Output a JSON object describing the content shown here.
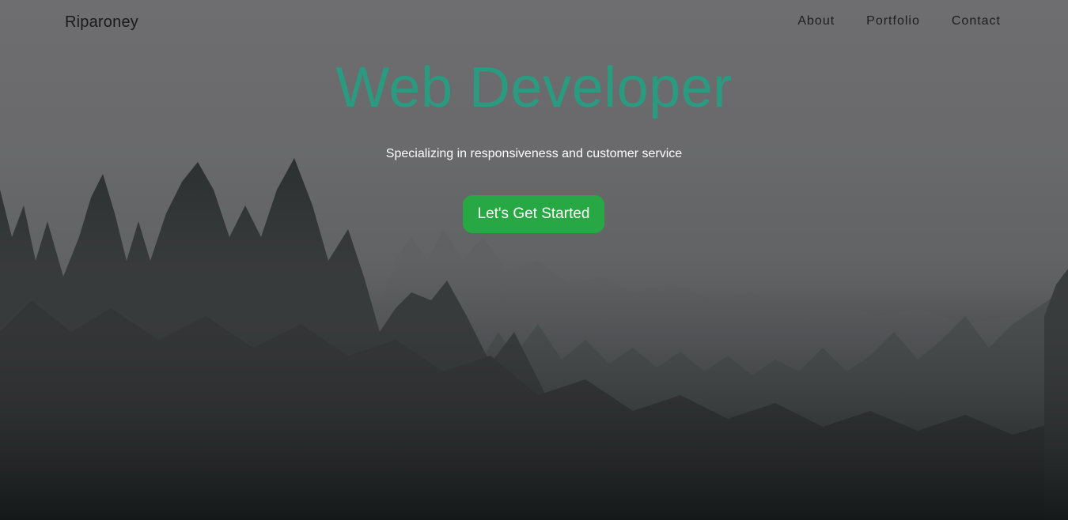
{
  "brand": {
    "name": "Riparoney"
  },
  "nav": {
    "items": [
      {
        "label": "About"
      },
      {
        "label": "Portfolio"
      },
      {
        "label": "Contact"
      }
    ]
  },
  "hero": {
    "title": "Web Developer",
    "subtitle": "Specializing in responsiveness and customer service",
    "cta_label": "Let's Get Started",
    "background": "misty-pine-forest-photo"
  },
  "colors": {
    "title": "#2a9a80",
    "cta": "#28a745",
    "subtitle": "#ffffff",
    "nav_text": "#1e1e1e"
  }
}
